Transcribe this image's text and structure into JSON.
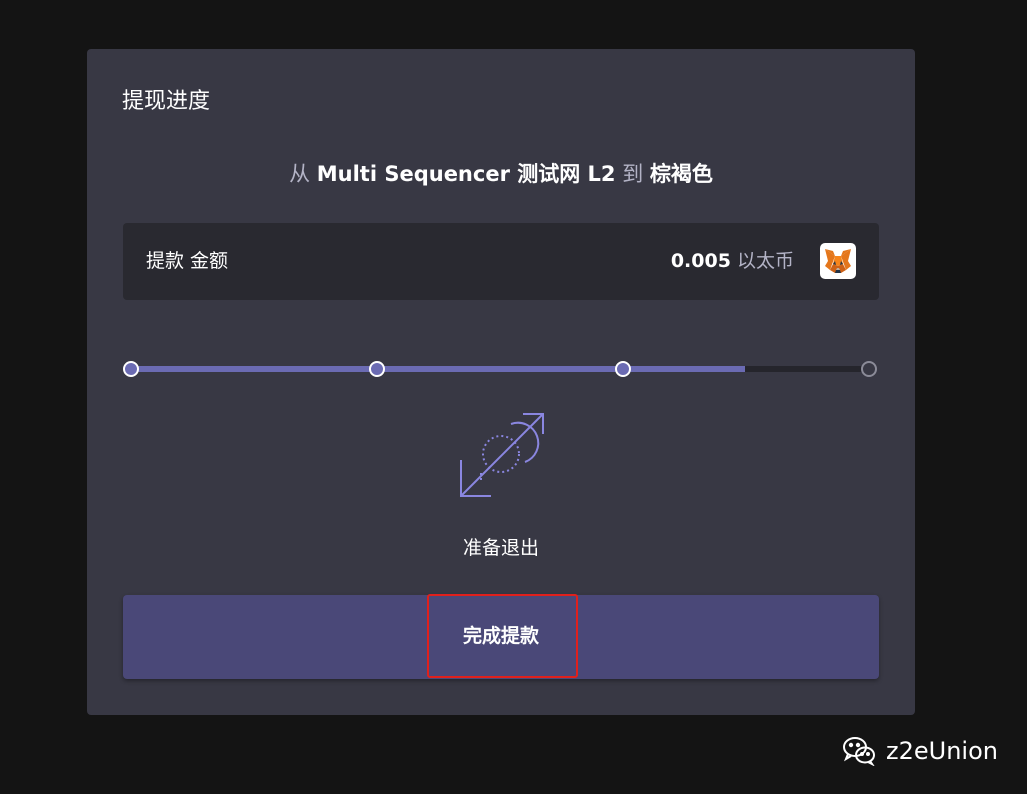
{
  "card": {
    "title": "提现进度"
  },
  "route": {
    "from_prefix": "从",
    "from_network": "Multi Sequencer 测试网 L2",
    "to_prefix": "到",
    "to_network": "棕褐色"
  },
  "amount": {
    "label": "提款 金额",
    "value": "0.005",
    "unit": "以太币",
    "wallet_icon": "metamask-fox-icon"
  },
  "progress": {
    "total_steps": 4,
    "completed_steps": 3,
    "fill_fraction": 0.83
  },
  "status": {
    "icon": "bridge-exit-icon",
    "text": "准备退出"
  },
  "action": {
    "finish_label": "完成提款"
  },
  "watermark": {
    "icon": "wechat-icon",
    "text": "z2eUnion"
  },
  "colors": {
    "background": "#141414",
    "card": "#383844",
    "panel": "#292930",
    "accent": "#6b6bb3",
    "button": "#4a4878",
    "highlight": "#e0201c"
  }
}
